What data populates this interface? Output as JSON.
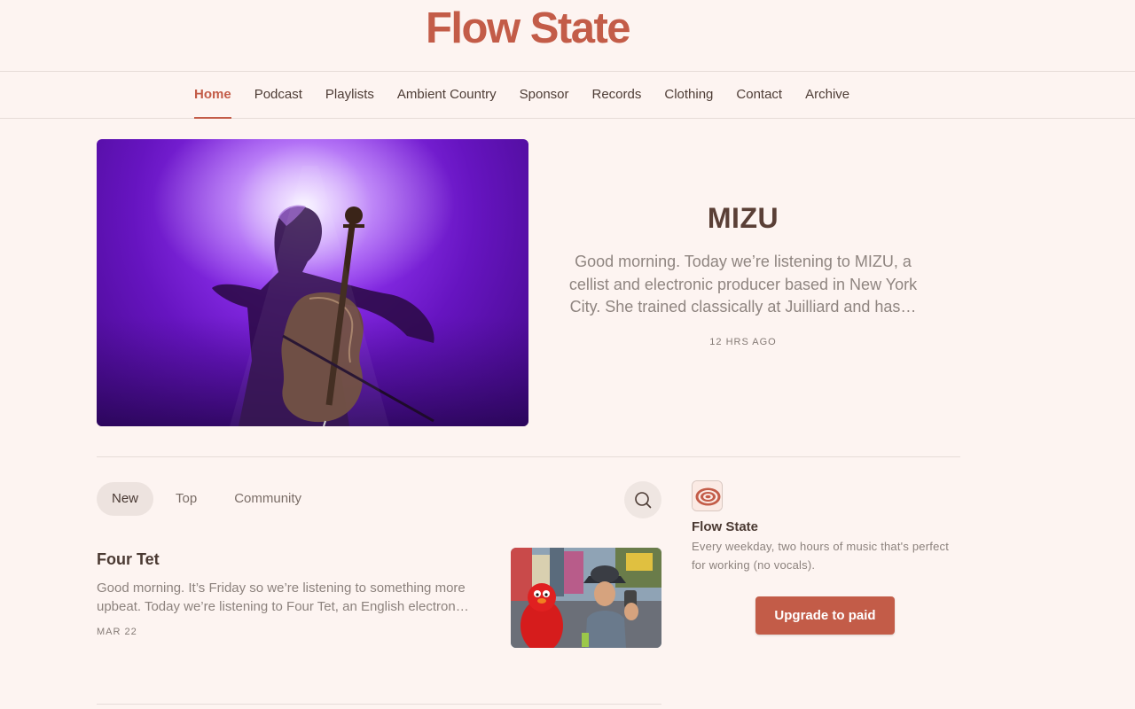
{
  "header": {
    "title": "Flow State"
  },
  "nav": {
    "items": [
      {
        "label": "Home",
        "active": true
      },
      {
        "label": "Podcast"
      },
      {
        "label": "Playlists"
      },
      {
        "label": "Ambient Country"
      },
      {
        "label": "Sponsor"
      },
      {
        "label": "Records"
      },
      {
        "label": "Clothing"
      },
      {
        "label": "Contact"
      },
      {
        "label": "Archive"
      }
    ]
  },
  "hero": {
    "title": "MIZU",
    "excerpt": "Good morning. Today we’re listening to MIZU, a cellist and electronic producer based in New York City. She trained classically at Juilliard and has…",
    "time": "12 HRS AGO"
  },
  "feed": {
    "tabs": [
      {
        "label": "New",
        "active": true
      },
      {
        "label": "Top"
      },
      {
        "label": "Community"
      }
    ],
    "search_icon": "search-icon",
    "posts": [
      {
        "title": "Four Tet",
        "excerpt": "Good morning. It’s Friday so we’re listening to something more upbeat. Today we’re listening to Four Tet, an English electron…",
        "date": "MAR 22"
      }
    ]
  },
  "sidebar": {
    "name": "Flow State",
    "description": "Every weekday, two hours of music that's perfect for working (no vocals).",
    "upgrade_label": "Upgrade to paid"
  },
  "colors": {
    "accent": "#c35c48",
    "background": "#fdf4f1"
  }
}
